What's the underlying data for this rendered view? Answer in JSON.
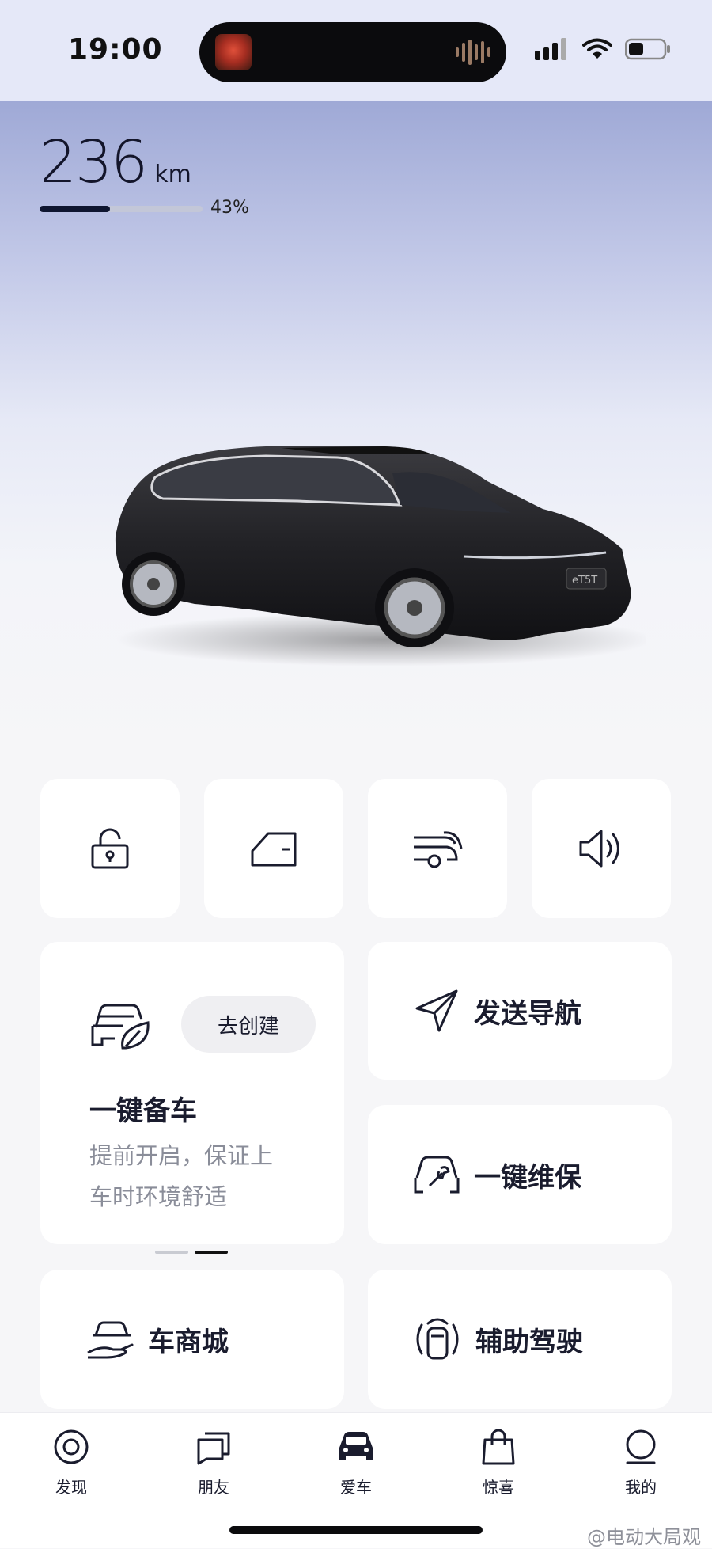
{
  "status_bar": {
    "time": "19:00"
  },
  "vehicle": {
    "range_value": "236",
    "range_unit": "km",
    "battery_percent_label": "43%",
    "battery_fraction": 0.43,
    "model_badge": "eT5T"
  },
  "quick_controls": [
    {
      "icon": "lock-icon"
    },
    {
      "icon": "car-door-icon"
    },
    {
      "icon": "trunk-icon"
    },
    {
      "icon": "speaker-icon"
    }
  ],
  "prep_card": {
    "icon": "car-leaf-icon",
    "create_button": "去创建",
    "title": "一键备车",
    "subtitle": "提前开启，保证上\n车时环境舒适"
  },
  "actions": {
    "send_nav": {
      "icon": "navigation-arrow-icon",
      "label": "发送导航"
    },
    "maintenance": {
      "icon": "car-wrench-icon",
      "label": "一键维保"
    },
    "car_store": {
      "icon": "car-hand-icon",
      "label": "车商城"
    },
    "assisted_driving": {
      "icon": "assisted-driving-icon",
      "label": "辅助驾驶"
    }
  },
  "carousel": {
    "pages": 2,
    "active": 2
  },
  "tabs": [
    {
      "label": "发现",
      "icon": "discover-icon"
    },
    {
      "label": "朋友",
      "icon": "chat-icon"
    },
    {
      "label": "爱车",
      "icon": "car-icon",
      "active": true
    },
    {
      "label": "惊喜",
      "icon": "shopping-bag-icon"
    },
    {
      "label": "我的",
      "icon": "profile-icon"
    }
  ],
  "watermark": "@电动大局观"
}
